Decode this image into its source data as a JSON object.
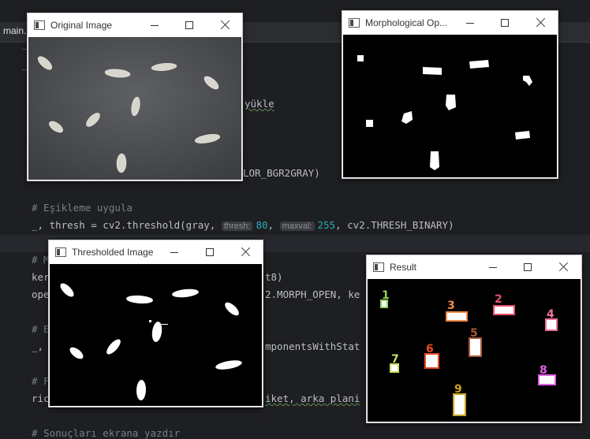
{
  "ide": {
    "tab_label": "main.",
    "lines": {
      "l1_tail": "yükle",
      "l2_tail": "LOR_BGR2GRAY)",
      "comment_threshold": "# Eşikleme uygula",
      "thresh_pre": "_, thresh = cv2.threshold(gray, ",
      "hint_thresh": "thresh:",
      "val_thresh": "80",
      "comma1": ", ",
      "hint_maxval": "maxval:",
      "val_maxval": "255",
      "thresh_post": ", cv2.THRESH_BINARY)",
      "c_m": "# M",
      "ker": "ker",
      "ker_tail": "t8)",
      "ope": "ope",
      "ope_tail": "2.MORPH_OPEN, ke",
      "c_e": "# E",
      "dash": "_,",
      "cc_tail": "mponentsWithStat",
      "c_f": "# F",
      "ric": "ric",
      "ric_tail": "iket, arka plani",
      "last_comment": "# Sonuçları ekrana yazdır"
    }
  },
  "windows": {
    "original": {
      "title": "Original Image"
    },
    "morph": {
      "title": "Morphological Op..."
    },
    "thresholded": {
      "title": "Thresholded Image"
    },
    "result": {
      "title": "Result",
      "labels": [
        {
          "text": "1",
          "color": "#8fd35a"
        },
        {
          "text": "2",
          "color": "#e8506a"
        },
        {
          "text": "3",
          "color": "#f08c48"
        },
        {
          "text": "4",
          "color": "#f070a0"
        },
        {
          "text": "5",
          "color": "#a8583a"
        },
        {
          "text": "6",
          "color": "#e84a1c"
        },
        {
          "text": "7",
          "color": "#c8e060"
        },
        {
          "text": "8",
          "color": "#e060e8"
        },
        {
          "text": "9",
          "color": "#c8a020"
        }
      ]
    }
  }
}
